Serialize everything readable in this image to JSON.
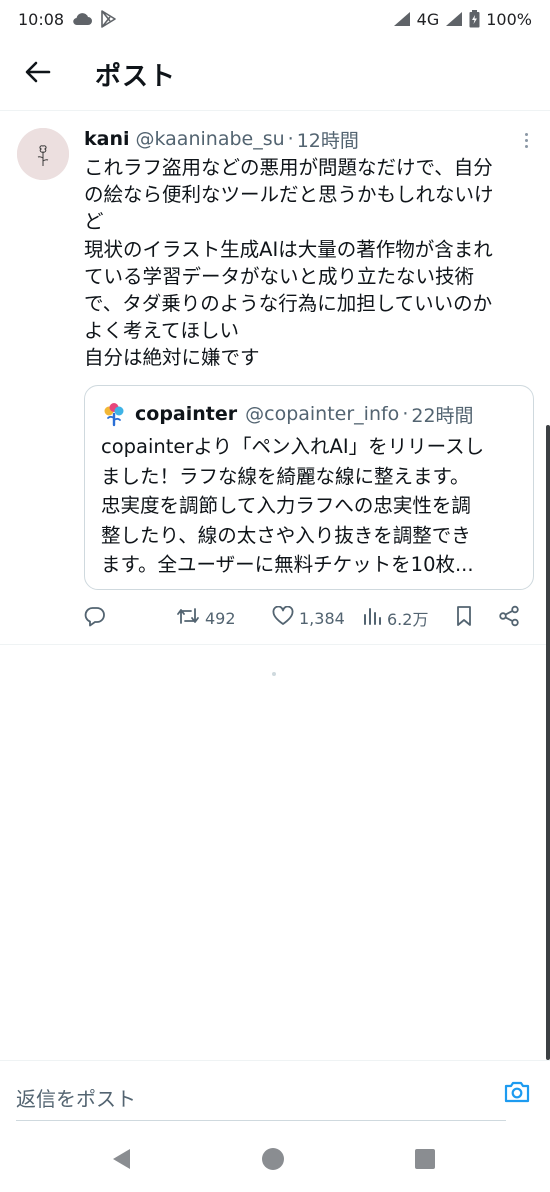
{
  "status_bar": {
    "time": "10:08",
    "network": "4G",
    "battery": "100%",
    "icons": [
      "cloud-icon",
      "play-store-icon",
      "signal-icon",
      "battery-icon"
    ]
  },
  "header": {
    "title": "ポスト",
    "back_icon": "arrow-left-icon"
  },
  "post": {
    "author_name": "kani",
    "author_handle": "@kaaninabe_su",
    "separator": "·",
    "time": "12時間",
    "text_lines": [
      "これラフ盗用などの悪用が問題なだけで、自分",
      "の絵なら便利なツールだと思うかもしれないけ",
      "ど",
      "現状のイラスト生成AIは大量の著作物が含まれ",
      "ている学習データがないと成り立たない技術",
      "で、タダ乗りのような行為に加担していいのか",
      "よく考えてほしい",
      "自分は絶対に嫌です"
    ],
    "quote": {
      "author_name": "copainter",
      "author_handle": "@copainter_info",
      "separator": "·",
      "time": "22時間",
      "text_lines": [
        "copainterより「ペン入れAI」をリリースし",
        "ました！ラフな線を綺麗な線に整えます。",
        "忠実度を調節して入力ラフへの忠実性を調",
        "整したり、線の太さや入り抜きを調整でき",
        "ます。全ユーザーに無料チケットを10枚..."
      ]
    },
    "actions": {
      "retweets": "492",
      "likes": "1,384",
      "views": "6.2万"
    }
  },
  "reply_bar": {
    "placeholder": "返信をポスト"
  },
  "colors": {
    "text": "#0f1419",
    "secondary": "#536471",
    "border": "#cfd9de",
    "accent": "#1d9bf0"
  }
}
